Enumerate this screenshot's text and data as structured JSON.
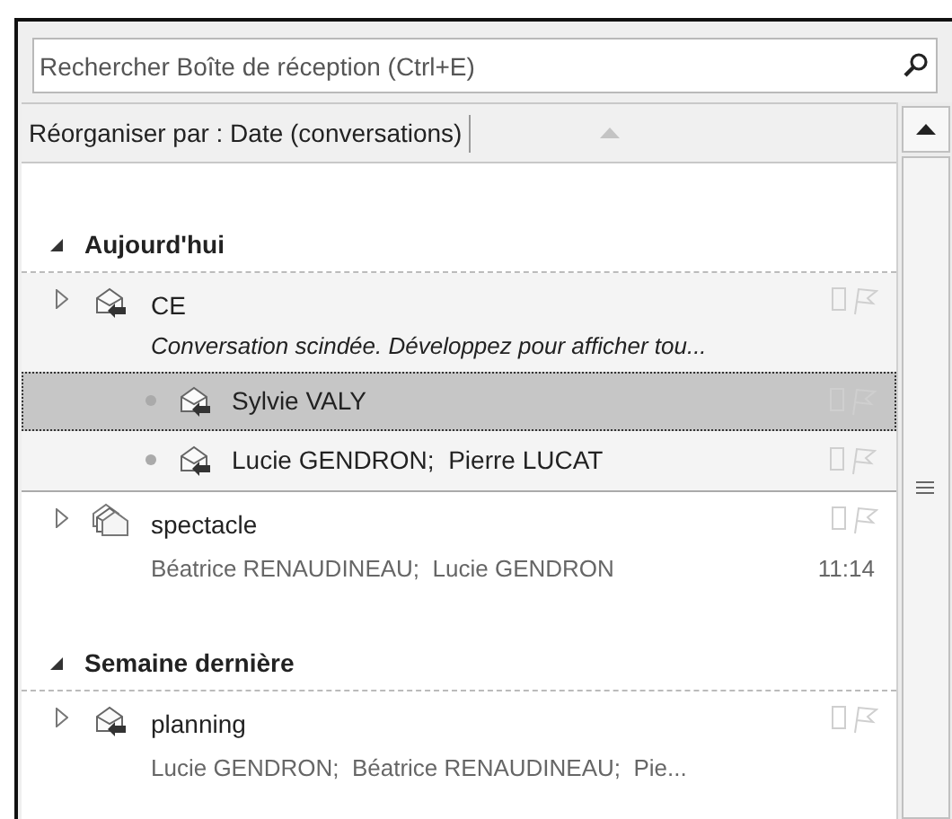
{
  "search": {
    "placeholder": "Rechercher Boîte de réception (Ctrl+E)"
  },
  "arrange": {
    "label": "Réorganiser par : Date (conversations)"
  },
  "groups": [
    {
      "label": "Aujourd'hui",
      "expanded": true,
      "items": [
        {
          "subject": "CE",
          "expanded": false,
          "replied": true,
          "preview": "Conversation scindée. Développez pour afficher tou...",
          "children": [
            {
              "sender": "Sylvie VALY",
              "selected": true
            },
            {
              "sender": "Lucie GENDRON;  Pierre LUCAT",
              "selected": false
            }
          ]
        },
        {
          "subject": "spectacle",
          "expanded": false,
          "replied": false,
          "senders": "Béatrice RENAUDINEAU;  Lucie GENDRON",
          "time": "11:14"
        }
      ]
    },
    {
      "label": "Semaine dernière",
      "expanded": true,
      "items": [
        {
          "subject": "planning",
          "expanded": false,
          "replied": true,
          "senders": "Lucie GENDRON;  Béatrice RENAUDINEAU;  Pie..."
        }
      ]
    }
  ]
}
